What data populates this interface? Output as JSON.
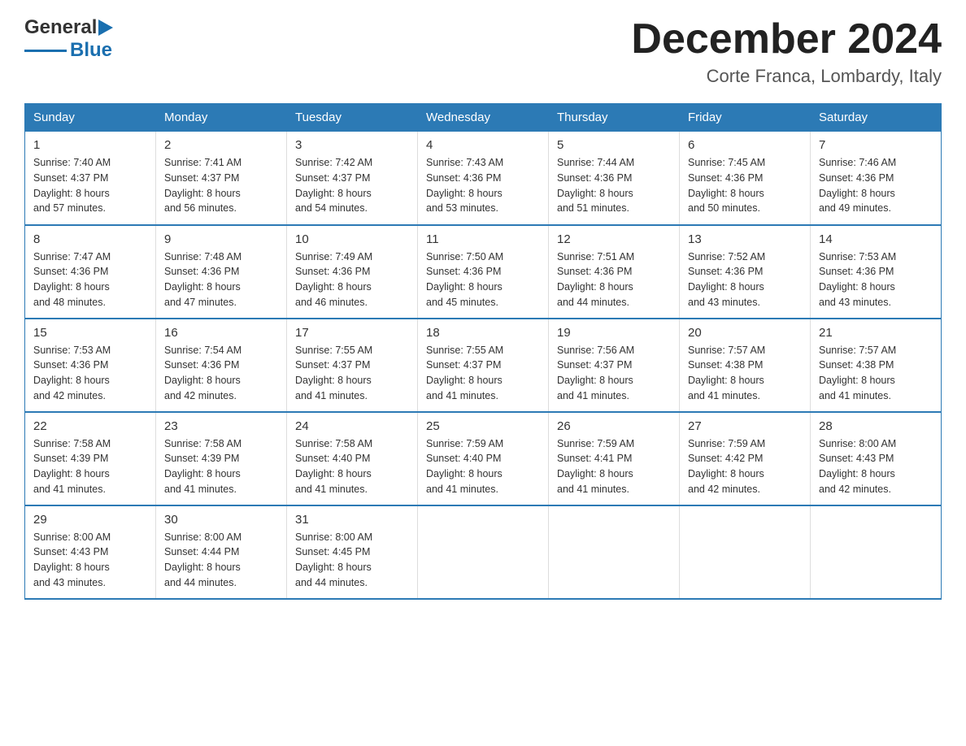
{
  "header": {
    "title": "December 2024",
    "location": "Corte Franca, Lombardy, Italy",
    "logo_general": "General",
    "logo_blue": "Blue"
  },
  "days": [
    "Sunday",
    "Monday",
    "Tuesday",
    "Wednesday",
    "Thursday",
    "Friday",
    "Saturday"
  ],
  "weeks": [
    [
      {
        "num": "1",
        "sunrise": "7:40 AM",
        "sunset": "4:37 PM",
        "daylight": "8 hours and 57 minutes."
      },
      {
        "num": "2",
        "sunrise": "7:41 AM",
        "sunset": "4:37 PM",
        "daylight": "8 hours and 56 minutes."
      },
      {
        "num": "3",
        "sunrise": "7:42 AM",
        "sunset": "4:37 PM",
        "daylight": "8 hours and 54 minutes."
      },
      {
        "num": "4",
        "sunrise": "7:43 AM",
        "sunset": "4:36 PM",
        "daylight": "8 hours and 53 minutes."
      },
      {
        "num": "5",
        "sunrise": "7:44 AM",
        "sunset": "4:36 PM",
        "daylight": "8 hours and 51 minutes."
      },
      {
        "num": "6",
        "sunrise": "7:45 AM",
        "sunset": "4:36 PM",
        "daylight": "8 hours and 50 minutes."
      },
      {
        "num": "7",
        "sunrise": "7:46 AM",
        "sunset": "4:36 PM",
        "daylight": "8 hours and 49 minutes."
      }
    ],
    [
      {
        "num": "8",
        "sunrise": "7:47 AM",
        "sunset": "4:36 PM",
        "daylight": "8 hours and 48 minutes."
      },
      {
        "num": "9",
        "sunrise": "7:48 AM",
        "sunset": "4:36 PM",
        "daylight": "8 hours and 47 minutes."
      },
      {
        "num": "10",
        "sunrise": "7:49 AM",
        "sunset": "4:36 PM",
        "daylight": "8 hours and 46 minutes."
      },
      {
        "num": "11",
        "sunrise": "7:50 AM",
        "sunset": "4:36 PM",
        "daylight": "8 hours and 45 minutes."
      },
      {
        "num": "12",
        "sunrise": "7:51 AM",
        "sunset": "4:36 PM",
        "daylight": "8 hours and 44 minutes."
      },
      {
        "num": "13",
        "sunrise": "7:52 AM",
        "sunset": "4:36 PM",
        "daylight": "8 hours and 43 minutes."
      },
      {
        "num": "14",
        "sunrise": "7:53 AM",
        "sunset": "4:36 PM",
        "daylight": "8 hours and 43 minutes."
      }
    ],
    [
      {
        "num": "15",
        "sunrise": "7:53 AM",
        "sunset": "4:36 PM",
        "daylight": "8 hours and 42 minutes."
      },
      {
        "num": "16",
        "sunrise": "7:54 AM",
        "sunset": "4:36 PM",
        "daylight": "8 hours and 42 minutes."
      },
      {
        "num": "17",
        "sunrise": "7:55 AM",
        "sunset": "4:37 PM",
        "daylight": "8 hours and 41 minutes."
      },
      {
        "num": "18",
        "sunrise": "7:55 AM",
        "sunset": "4:37 PM",
        "daylight": "8 hours and 41 minutes."
      },
      {
        "num": "19",
        "sunrise": "7:56 AM",
        "sunset": "4:37 PM",
        "daylight": "8 hours and 41 minutes."
      },
      {
        "num": "20",
        "sunrise": "7:57 AM",
        "sunset": "4:38 PM",
        "daylight": "8 hours and 41 minutes."
      },
      {
        "num": "21",
        "sunrise": "7:57 AM",
        "sunset": "4:38 PM",
        "daylight": "8 hours and 41 minutes."
      }
    ],
    [
      {
        "num": "22",
        "sunrise": "7:58 AM",
        "sunset": "4:39 PM",
        "daylight": "8 hours and 41 minutes."
      },
      {
        "num": "23",
        "sunrise": "7:58 AM",
        "sunset": "4:39 PM",
        "daylight": "8 hours and 41 minutes."
      },
      {
        "num": "24",
        "sunrise": "7:58 AM",
        "sunset": "4:40 PM",
        "daylight": "8 hours and 41 minutes."
      },
      {
        "num": "25",
        "sunrise": "7:59 AM",
        "sunset": "4:40 PM",
        "daylight": "8 hours and 41 minutes."
      },
      {
        "num": "26",
        "sunrise": "7:59 AM",
        "sunset": "4:41 PM",
        "daylight": "8 hours and 41 minutes."
      },
      {
        "num": "27",
        "sunrise": "7:59 AM",
        "sunset": "4:42 PM",
        "daylight": "8 hours and 42 minutes."
      },
      {
        "num": "28",
        "sunrise": "8:00 AM",
        "sunset": "4:43 PM",
        "daylight": "8 hours and 42 minutes."
      }
    ],
    [
      {
        "num": "29",
        "sunrise": "8:00 AM",
        "sunset": "4:43 PM",
        "daylight": "8 hours and 43 minutes."
      },
      {
        "num": "30",
        "sunrise": "8:00 AM",
        "sunset": "4:44 PM",
        "daylight": "8 hours and 44 minutes."
      },
      {
        "num": "31",
        "sunrise": "8:00 AM",
        "sunset": "4:45 PM",
        "daylight": "8 hours and 44 minutes."
      },
      {
        "num": "",
        "sunrise": "",
        "sunset": "",
        "daylight": ""
      },
      {
        "num": "",
        "sunrise": "",
        "sunset": "",
        "daylight": ""
      },
      {
        "num": "",
        "sunrise": "",
        "sunset": "",
        "daylight": ""
      },
      {
        "num": "",
        "sunrise": "",
        "sunset": "",
        "daylight": ""
      }
    ]
  ],
  "labels": {
    "sunrise": "Sunrise:",
    "sunset": "Sunset:",
    "daylight": "Daylight:"
  }
}
